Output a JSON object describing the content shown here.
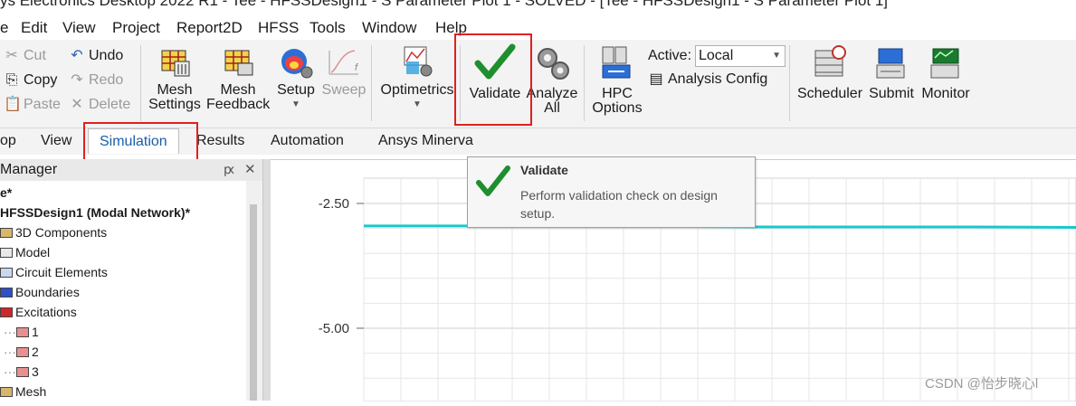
{
  "window": {
    "title": "ys Electronics Desktop 2022 R1 - Tee - HFSSDesign1 - S Parameter Plot 1 - SOLVED - [Tee - HFSSDesign1 - S Parameter Plot 1]"
  },
  "menu": [
    "e",
    "Edit",
    "View",
    "Project",
    "Report2D",
    "HFSS",
    "Tools",
    "Window",
    "Help"
  ],
  "ribbon": {
    "clipboard": {
      "cut": "Cut",
      "copy": "Copy",
      "paste": "Paste"
    },
    "history": {
      "undo": "Undo",
      "redo": "Redo",
      "delete": "Delete"
    },
    "mesh_settings": [
      "Mesh",
      "Settings"
    ],
    "mesh_feedback": [
      "Mesh",
      "Feedback"
    ],
    "setup": "Setup",
    "sweep": "Sweep",
    "optimetrics": "Optimetrics",
    "validate": "Validate",
    "analyze_all": [
      "Analyze",
      "All"
    ],
    "hpc_options": [
      "HPC",
      "Options"
    ],
    "active_label": "Active:",
    "active_value": "Local",
    "analysis_config": "Analysis Config",
    "scheduler": "Scheduler",
    "submit": "Submit",
    "monitor": "Monitor"
  },
  "tabs": [
    "op",
    "View",
    "Simulation",
    "Results",
    "Automation",
    "Ansys Minerva"
  ],
  "active_tab": "Simulation",
  "project_manager": {
    "title": "Manager",
    "pin": "ԗ",
    "close": "✕",
    "tree": [
      {
        "label": "e*",
        "bold": true
      },
      {
        "label": "HFSSDesign1 (Modal Network)*",
        "bold": true
      },
      {
        "label": "3D Components"
      },
      {
        "label": "Model"
      },
      {
        "label": "Circuit Elements"
      },
      {
        "label": "Boundaries"
      },
      {
        "label": "Excitations"
      },
      {
        "label": "1"
      },
      {
        "label": "2"
      },
      {
        "label": "3"
      },
      {
        "label": "Mesh"
      }
    ]
  },
  "tooltip": {
    "title": "Validate",
    "body": "Perform validation check on design setup."
  },
  "plot": {
    "y_ticks": [
      "-2.50",
      "-5.00"
    ]
  },
  "chart_data": {
    "type": "line",
    "y_ticks": [
      -2.5,
      -5.0
    ],
    "series": [
      {
        "color": "#19c8cc",
        "values": [
          -2.95,
          -2.95,
          -2.96,
          -2.96,
          -2.97,
          -2.97,
          -2.97,
          -2.98
        ]
      }
    ],
    "grid": true
  },
  "watermark": "CSDN @怡步晓心l"
}
